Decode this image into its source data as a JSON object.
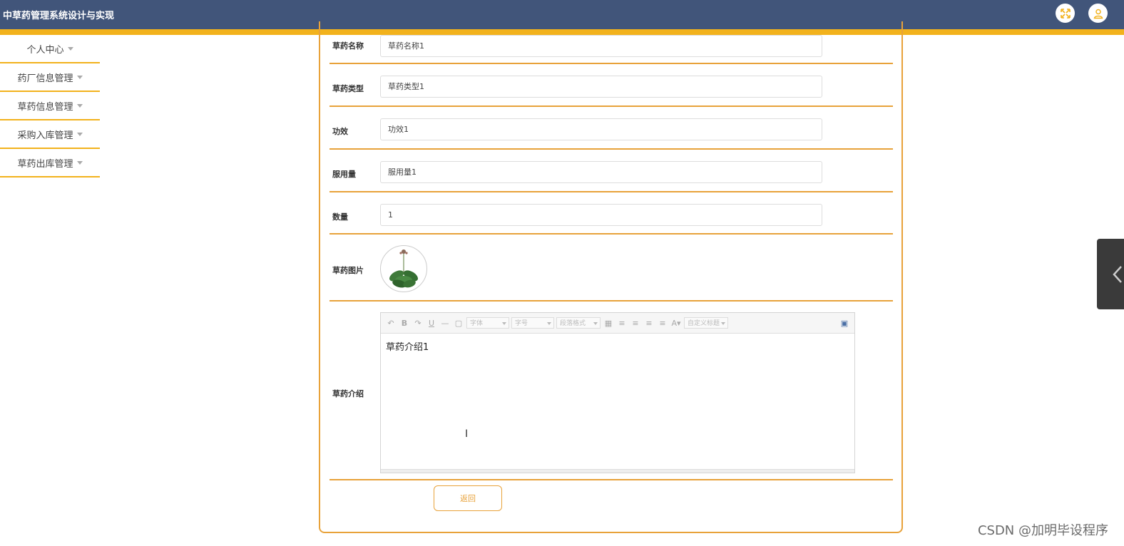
{
  "header": {
    "title": "中草药管理系统设计与实现",
    "colors": {
      "bar": "#41557a",
      "accent": "#f2b21c"
    },
    "icons": [
      "fullscreen-icon",
      "user-icon"
    ]
  },
  "sidebar": {
    "items": [
      {
        "label": "个人中心"
      },
      {
        "label": "药厂信息管理"
      },
      {
        "label": "草药信息管理"
      },
      {
        "label": "采购入库管理"
      },
      {
        "label": "草药出库管理"
      }
    ]
  },
  "form": {
    "fields": [
      {
        "label": "草药名称",
        "value": "草药名称1"
      },
      {
        "label": "草药类型",
        "value": "草药类型1"
      },
      {
        "label": "功效",
        "value": "功效1"
      },
      {
        "label": "服用量",
        "value": "服用量1"
      },
      {
        "label": "数量",
        "value": "1"
      }
    ],
    "image_label": "草药图片",
    "intro_label": "草药介绍",
    "editor": {
      "font_placeholder": "字体",
      "size_placeholder": "字号",
      "paragraph_placeholder": "段落格式",
      "custom_title_placeholder": "自定义标题",
      "content": "草药介绍1"
    },
    "back_button": "返回"
  },
  "watermark": "CSDN @加明毕设程序"
}
